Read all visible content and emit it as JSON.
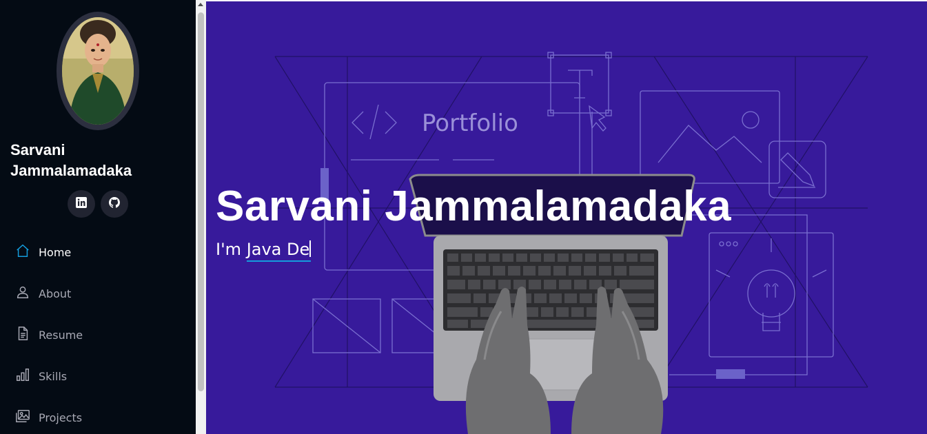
{
  "profile": {
    "name": "Sarvani Jammalamadaka"
  },
  "social": [
    {
      "icon": "linkedin-icon",
      "label": "in"
    },
    {
      "icon": "github-icon"
    }
  ],
  "nav": [
    {
      "label": "Home",
      "icon": "home-icon",
      "active": true
    },
    {
      "label": "About",
      "icon": "person-icon",
      "active": false
    },
    {
      "label": "Resume",
      "icon": "file-icon",
      "active": false
    },
    {
      "label": "Skills",
      "icon": "bar-chart-icon",
      "active": false
    },
    {
      "label": "Projects",
      "icon": "images-icon",
      "active": false
    }
  ],
  "hero": {
    "title": "Sarvani Jammalamadaka",
    "prefix": "I'm ",
    "typed": "Java De",
    "illustration_text": "Portfolio",
    "background_color": "#371a9b"
  },
  "colors": {
    "sidebar_bg": "#040b14",
    "accent": "#149ddd"
  }
}
